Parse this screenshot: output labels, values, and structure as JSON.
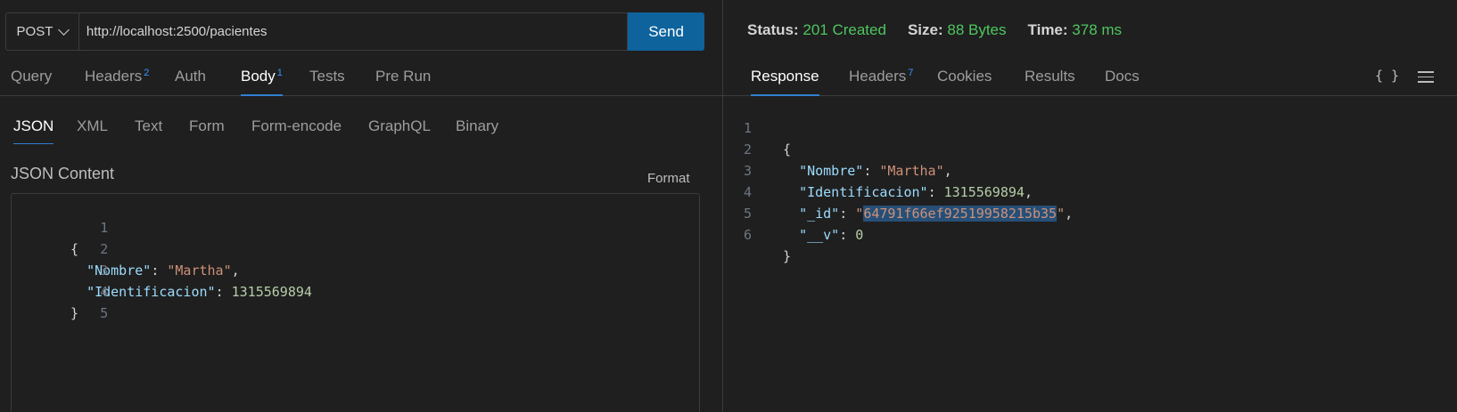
{
  "request": {
    "method": "POST",
    "url": "http://localhost:2500/pacientes",
    "send_label": "Send",
    "tabs": [
      {
        "label": "Query",
        "badge": ""
      },
      {
        "label": "Headers",
        "badge": "2"
      },
      {
        "label": "Auth",
        "badge": ""
      },
      {
        "label": "Body",
        "badge": "1"
      },
      {
        "label": "Tests",
        "badge": ""
      },
      {
        "label": "Pre Run",
        "badge": ""
      }
    ],
    "body_types": [
      "JSON",
      "XML",
      "Text",
      "Form",
      "Form-encode",
      "GraphQL",
      "Binary"
    ],
    "content_title": "JSON Content",
    "format_label": "Format",
    "line_numbers": [
      "1",
      "2",
      "3",
      "4",
      "5"
    ],
    "json_lines": {
      "l1_open": "{",
      "l2_key": "\"Nombre\"",
      "l2_colon": ": ",
      "l2_value": "\"Martha\"",
      "l2_comma": ",",
      "l3_key": "\"Identificacion\"",
      "l3_colon": ": ",
      "l3_value": "1315569894",
      "l4_close": "}"
    }
  },
  "response": {
    "status_label": "Status:",
    "status_value": "201 Created",
    "size_label": "Size:",
    "size_value": "88 Bytes",
    "time_label": "Time:",
    "time_value": "378 ms",
    "tabs": [
      {
        "label": "Response",
        "badge": ""
      },
      {
        "label": "Headers",
        "badge": "7"
      },
      {
        "label": "Cookies",
        "badge": ""
      },
      {
        "label": "Results",
        "badge": ""
      },
      {
        "label": "Docs",
        "badge": ""
      }
    ],
    "icons": {
      "braces": "{ }",
      "menu": "menu-icon"
    },
    "line_numbers": [
      "1",
      "2",
      "3",
      "4",
      "5",
      "6"
    ],
    "json_lines": {
      "l1_open": "{",
      "l2_key": "\"Nombre\"",
      "l2_colon": ": ",
      "l2_value": "\"Martha\"",
      "l2_comma": ",",
      "l3_key": "\"Identificacion\"",
      "l3_colon": ": ",
      "l3_value": "1315569894",
      "l3_comma": ",",
      "l4_key": "\"_id\"",
      "l4_colon": ": ",
      "l4_quote_open": "\"",
      "l4_value": "64791f66ef92519958215b35",
      "l4_quote_close": "\"",
      "l4_comma": ",",
      "l5_key": "\"__v\"",
      "l5_colon": ": ",
      "l5_value": "0",
      "l6_close": "}"
    }
  },
  "colors": {
    "background": "#1f1f1f",
    "accent": "#0e639c",
    "tab_underline": "#2f7fd1",
    "status_ok": "#4ec65f",
    "json_key": "#9cdcfe",
    "json_string": "#ce9178",
    "json_number": "#b5cea8",
    "selection": "#264f78"
  }
}
